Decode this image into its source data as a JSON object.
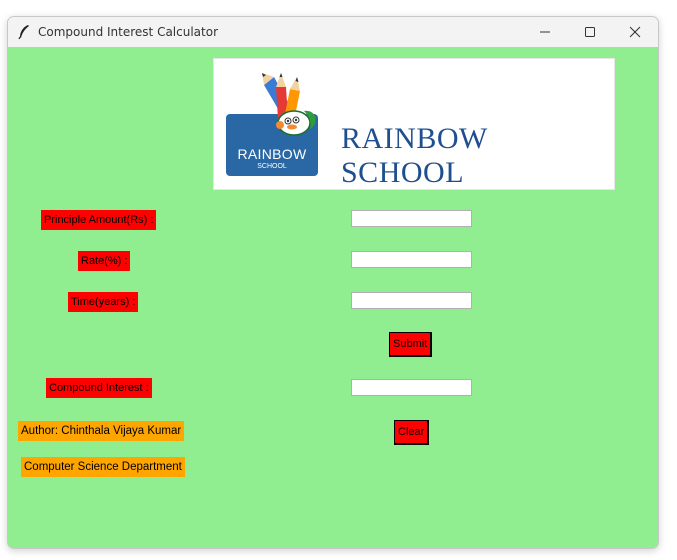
{
  "window": {
    "title": "Compound Interest Calculator",
    "icons": {
      "app": "feather-icon",
      "minimize": "minimize-icon",
      "maximize": "maximize-icon",
      "close": "close-icon"
    }
  },
  "colors": {
    "background": "#90ee90",
    "label_red": "#ff0000",
    "label_orange": "#ffa500",
    "logo_blue": "#2a68a5",
    "logo_text": "#1f4f8f"
  },
  "logo": {
    "badge_title": "RAINBOW",
    "badge_subtitle": "SCHOOL",
    "text": "RAINBOW SCHOOL"
  },
  "form": {
    "principal_label": "Principle Amount(Rs) :",
    "principal_value": "",
    "rate_label": "Rate(%) :",
    "rate_value": "",
    "time_label": "Time(years) :",
    "time_value": "",
    "submit_label": "Submit",
    "ci_label": "Compound Interest :",
    "ci_value": "",
    "clear_label": "Clear"
  },
  "footer": {
    "author": "Author: Chinthala Vijaya Kumar",
    "department": "Computer Science Department"
  }
}
